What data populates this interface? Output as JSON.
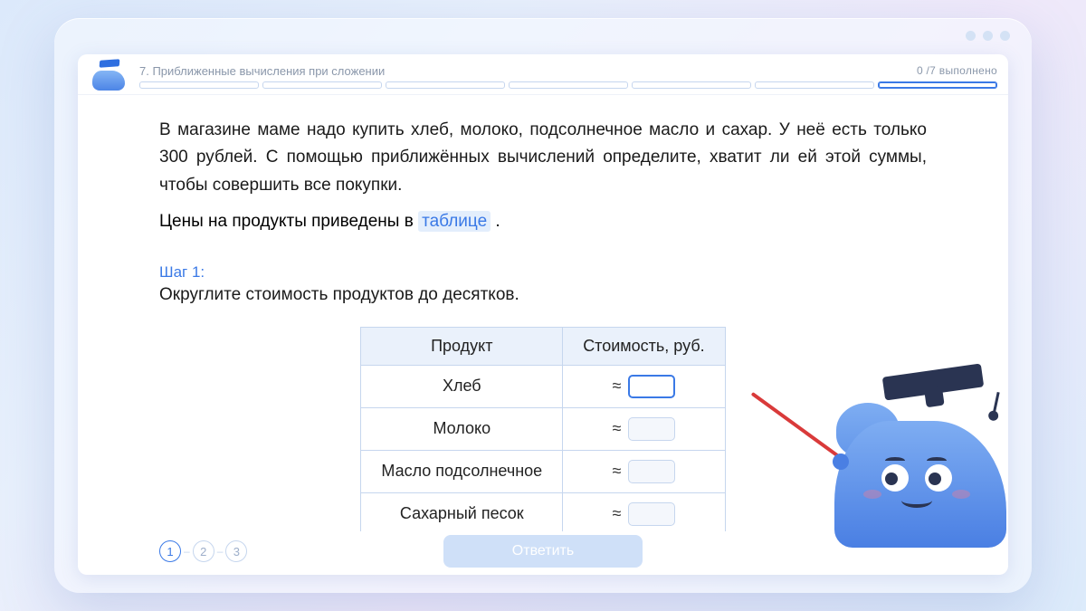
{
  "header": {
    "title": "7. Приближенные вычисления при сложении",
    "progress": "0 /7 выполнено",
    "segments": 7,
    "active_segment": 6
  },
  "problem": {
    "text1": "В магазине маме надо купить хлеб, молоко, подсолнечное масло и сахар. У неё есть только 300 рублей. С помощью приближённых вычислений определите, хватит ли ей этой суммы, чтобы совершить все покупки.",
    "text2_prefix": "Цены на продукты приведены в ",
    "text2_link": "таблице",
    "text2_suffix": " ."
  },
  "step": {
    "label": "Шаг 1:",
    "text": "Округлите стоимость продуктов до десятков."
  },
  "table": {
    "col1": "Продукт",
    "col2": "Стоимость, руб.",
    "rows": [
      {
        "product": "Хлеб",
        "focused": true
      },
      {
        "product": "Молоко",
        "focused": false
      },
      {
        "product": "Масло подсолнечное",
        "focused": false
      },
      {
        "product": "Сахарный песок",
        "focused": false
      }
    ],
    "approx_symbol": "≈"
  },
  "pager": {
    "items": [
      "1",
      "2",
      "3"
    ],
    "current": 0
  },
  "footer": {
    "answer_label": "Ответить"
  }
}
